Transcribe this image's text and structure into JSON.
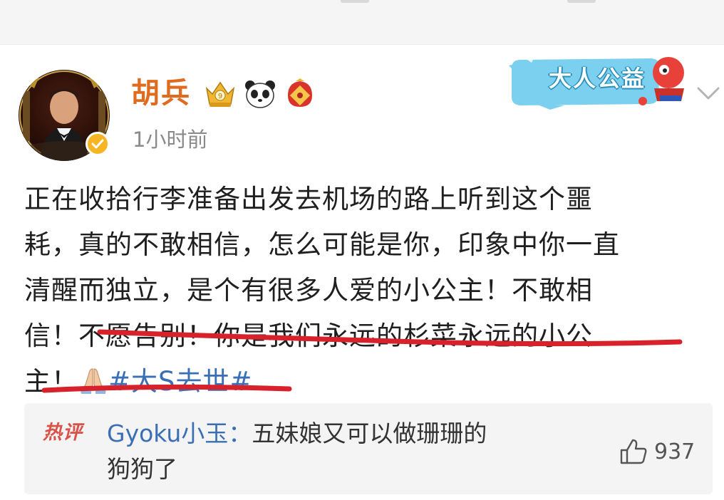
{
  "post": {
    "author": "胡兵",
    "time": "1小时前",
    "banner_text": "大人公益",
    "text_lines": [
      "正在收拾行李准备出发去机场的路上听到这个噩",
      "耗，真的不敢相信，怎么可能是你，印象中你一直",
      "清醒而独立，是个有很多人爱的小公主！不敢相",
      "信！不愿告别！你是我们永远的杉菜永远的小公"
    ],
    "last_line_prefix": "主！",
    "hashtag": "#大S去世#",
    "badges": [
      "crown-badge",
      "panda-badge",
      "fu-badge"
    ]
  },
  "hot_comment": {
    "tag": "热评",
    "user": "Gyoku小玉",
    "separator": "：",
    "text_line1": "五妹娘又可以做珊珊的",
    "text_line2": "狗狗了",
    "likes": "937"
  },
  "colors": {
    "author": "#e06b1f",
    "hashtag": "#3a6fb5",
    "underline": "#d7212b",
    "hot_tag": "#d9534a"
  }
}
